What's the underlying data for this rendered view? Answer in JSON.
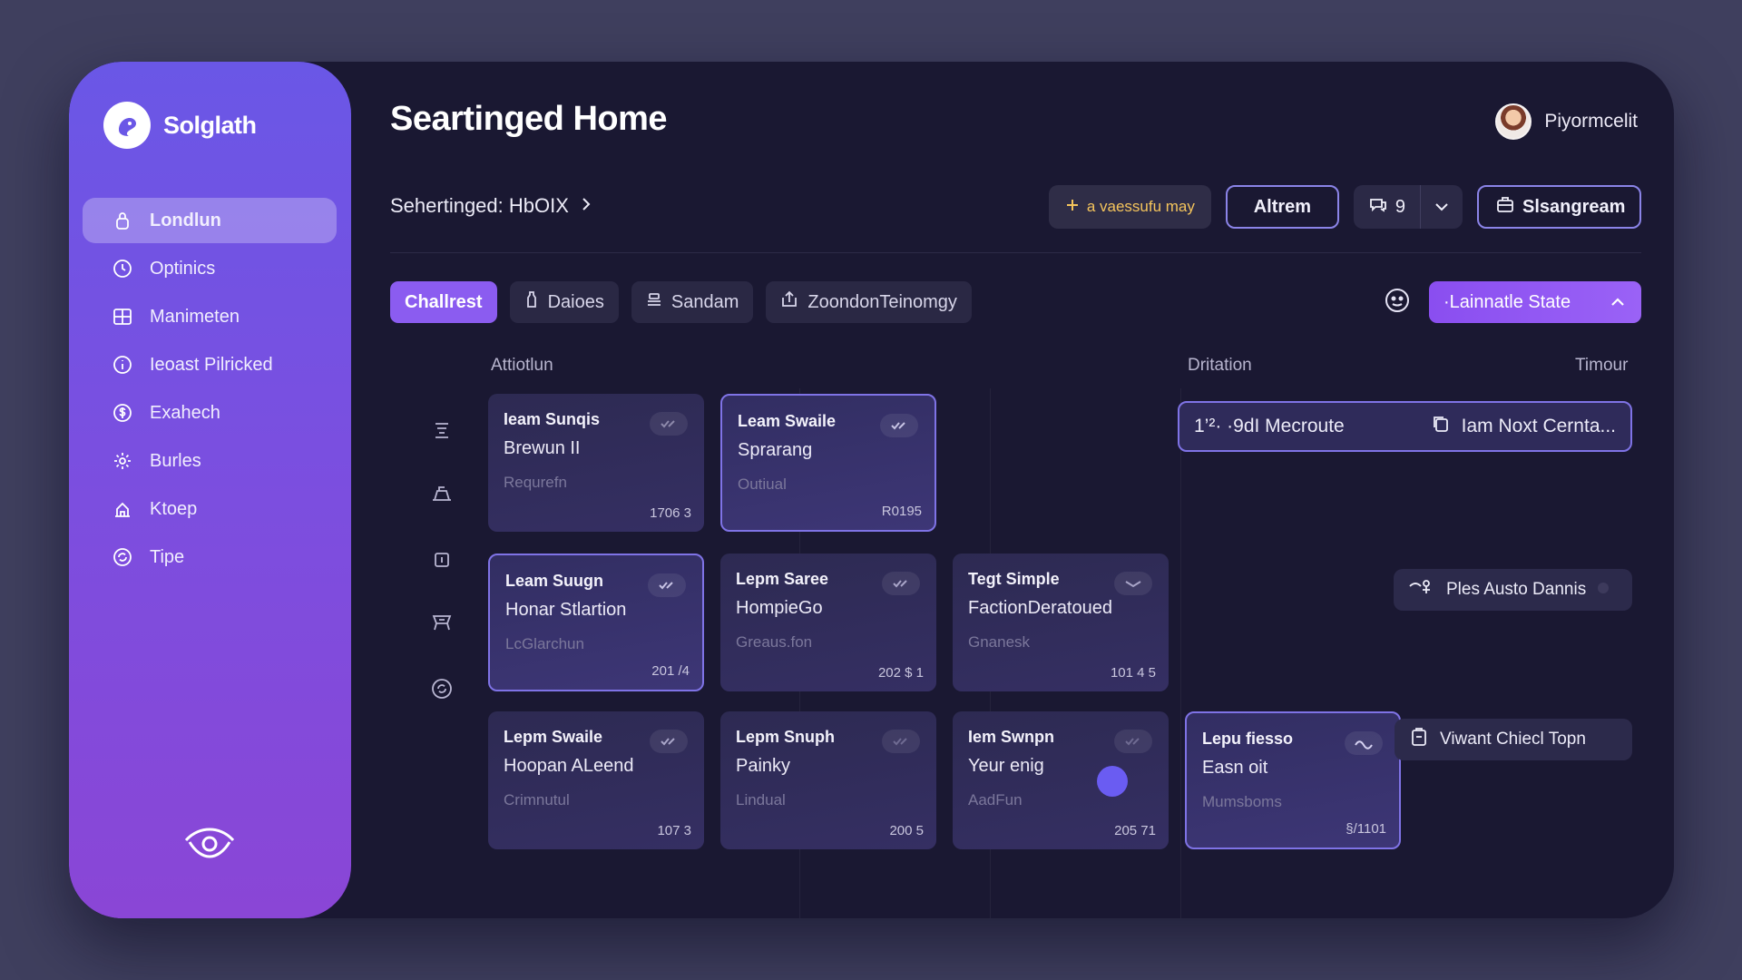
{
  "app": {
    "brand": "Solglath",
    "icon": "logo-icon"
  },
  "sidebar": {
    "items": [
      {
        "label": "Londlun",
        "icon": "lock-icon",
        "active": true
      },
      {
        "label": "Optinics",
        "icon": "clock-icon"
      },
      {
        "label": "Manimeten",
        "icon": "grid-icon"
      },
      {
        "label": "Ieoast Pilricked",
        "icon": "info-icon"
      },
      {
        "label": "Exahech",
        "icon": "dollar-icon"
      },
      {
        "label": "Burles",
        "icon": "gear-icon"
      },
      {
        "label": "Ktoep",
        "icon": "home-icon"
      },
      {
        "label": "Tipe",
        "icon": "refresh-icon"
      }
    ],
    "footer_icon": "eye-icon"
  },
  "header": {
    "title": "Seartinged Home",
    "user_name": "Piyormcelit",
    "breadcrumb": "Sehertinged: HbOIX"
  },
  "toolbar": {
    "hint": "a vaessufu may",
    "primary_label": "Altrem",
    "count": "9",
    "export_label": "Slsangream"
  },
  "tabs": [
    {
      "label": "Challrest",
      "active": true
    },
    {
      "label": "Daioes",
      "icon": "bottle-icon"
    },
    {
      "label": "Sandam",
      "icon": "stack-icon"
    },
    {
      "label": "ZoondonTeinomgy",
      "icon": "upload-icon"
    }
  ],
  "state_button": "·Lainnatle State",
  "columns": {
    "left": "Attiotlun",
    "middle": "Dritation",
    "right": "Timour"
  },
  "cards": [
    {
      "title": "Ieam Sunqis",
      "sub": "Brewun II",
      "meta": "Requrefn",
      "num": "1706 3"
    },
    {
      "title": "Leam Swaile",
      "sub": "Sprarang",
      "meta": "Outiual",
      "num": "R0195"
    },
    {
      "title": "Leam Suugn",
      "sub": "Honar Stlartion",
      "meta": "LcGlarchun",
      "num": "201 /4"
    },
    {
      "title": "Lepm Saree",
      "sub": "HompieGo",
      "meta": "Greaus.fon",
      "num": "202 $ 1"
    },
    {
      "title": "Tegt Simple",
      "sub": "FactionDeratoued",
      "meta": "Gnanesk",
      "num": "101 4 5"
    },
    {
      "title": "Lepm Swaile",
      "sub": "Hoopan ALeend",
      "meta": "Crimnutul",
      "num": "107 3"
    },
    {
      "title": "Lepm Snuph",
      "sub": "Painky",
      "meta": "Lindual",
      "num": "200 5"
    },
    {
      "title": "Iem Swnpn",
      "sub": "Yeur enig",
      "meta": "AadFun",
      "num": "205 71"
    },
    {
      "title": "Lepu fiesso",
      "sub": "Easn oit",
      "meta": "Mumsboms",
      "num": "§/1101"
    }
  ],
  "side_pills": {
    "route": "1’²· ·9dI Mecroute",
    "route_next": "Iam Noxt Cernta...",
    "auto": "Ples Austo Dannis",
    "view": "Viwant Chiecl Topn"
  }
}
